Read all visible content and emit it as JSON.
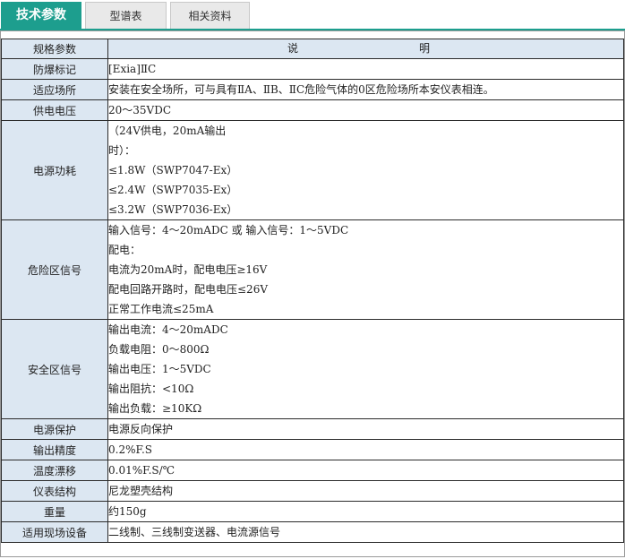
{
  "tabs": [
    {
      "label": "技术参数",
      "active": true
    },
    {
      "label": "型谱表",
      "active": false
    },
    {
      "label": "相关资料",
      "active": false
    }
  ],
  "table": {
    "header": {
      "key": "规格参数",
      "value_left": "说",
      "value_right": "明"
    },
    "rows": [
      {
        "key": "防爆标记",
        "lines": [
          "[Exia]ⅡC"
        ]
      },
      {
        "key": "适应场所",
        "lines": [
          "安装在安全场所，可与具有ⅡA、ⅡB、ⅡC危险气体的0区危险场所本安仪表相连。"
        ]
      },
      {
        "key": "供电电压",
        "lines": [
          "20～35VDC"
        ]
      },
      {
        "key": "电源功耗",
        "lines": [
          "（24V供电，20mA输出",
          "时）：",
          "≤1.8W（SWP7047-Ex）",
          "≤2.4W（SWP7035-Ex）",
          "≤3.2W（SWP7036-Ex）"
        ]
      },
      {
        "key": "危险区信号",
        "lines": [
          "输入信号：4～20mADC 或  输入信号：1～5VDC",
          "配电：",
          "电流为20mA时，配电电压≥16V",
          "配电回路开路时，配电电压≤26V",
          "正常工作电流≤25mA"
        ]
      },
      {
        "key": "安全区信号",
        "lines": [
          "输出电流：4～20mADC",
          "负载电阻：0～800Ω",
          "输出电压：1～5VDC",
          "输出阻抗：<10Ω",
          "输出负载：≥10KΩ"
        ]
      },
      {
        "key": "电源保护",
        "lines": [
          "电源反向保护"
        ]
      },
      {
        "key": "输出精度",
        "lines": [
          "0.2%F.S"
        ]
      },
      {
        "key": "温度漂移",
        "lines": [
          "0.01%F.S/℃"
        ]
      },
      {
        "key": "仪表结构",
        "lines": [
          "尼龙塑壳结构"
        ]
      },
      {
        "key": "重量",
        "lines": [
          "约150g"
        ]
      },
      {
        "key": "适用现场设备",
        "lines": [
          "二线制、三线制变送器、电流源信号"
        ]
      }
    ]
  }
}
